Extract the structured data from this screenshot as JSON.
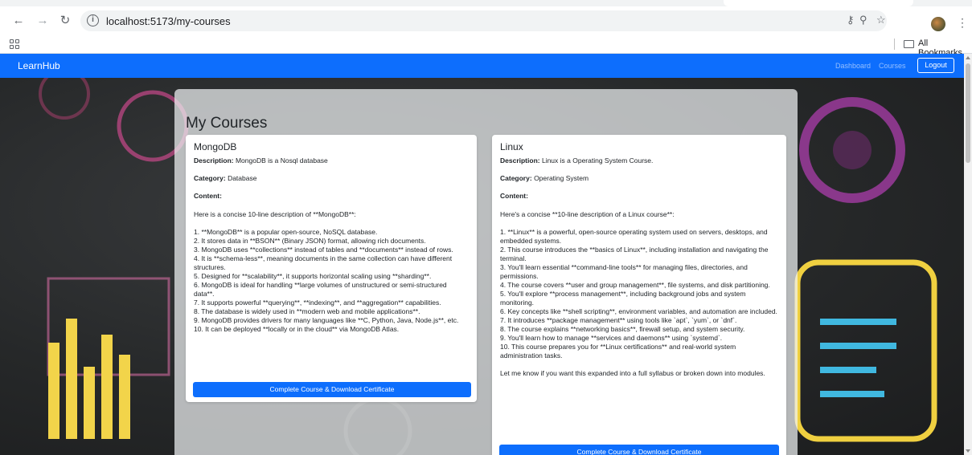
{
  "browser": {
    "url": "localhost:5173/my-courses",
    "bookmarks_label": "All Bookmarks"
  },
  "navbar": {
    "brand": "LearnHub",
    "links": [
      "Dashboard",
      "Courses"
    ],
    "logout_label": "Logout"
  },
  "page": {
    "title": "My Courses"
  },
  "labels": {
    "description": "Description:",
    "category": "Category:",
    "content": "Content:"
  },
  "courses": [
    {
      "title": "MongoDB",
      "description": "MongoDB is a Nosql database",
      "category": "Database",
      "content": "Here is a concise 10-line description of **MongoDB**:\n\n1. **MongoDB** is a popular open-source, NoSQL database.\n2. It stores data in **BSON** (Binary JSON) format, allowing rich documents.\n3. MongoDB uses **collections** instead of tables and **documents** instead of rows.\n4. It is **schema-less**, meaning documents in the same collection can have different structures.\n5. Designed for **scalability**, it supports horizontal scaling using **sharding**.\n6. MongoDB is ideal for handling **large volumes of unstructured or semi-structured data**.\n7. It supports powerful **querying**, **indexing**, and **aggregation** capabilities.\n8. The database is widely used in **modern web and mobile applications**.\n9. MongoDB provides drivers for many languages like **C, Python, Java, Node.js**, etc.\n10. It can be deployed **locally or in the cloud** via MongoDB Atlas.",
      "button_label": "Complete Course & Download Certificate"
    },
    {
      "title": "Linux",
      "description": "Linux is a Operating System Course.",
      "category": "Operating System",
      "content": "Here's a concise **10-line description of a Linux course**:\n\n1. **Linux** is a powerful, open-source operating system used on servers, desktops, and embedded systems.\n2. This course introduces the **basics of Linux**, including installation and navigating the terminal.\n3. You'll learn essential **command-line tools** for managing files, directories, and permissions.\n4. The course covers **user and group management**, file systems, and disk partitioning.\n5. You'll explore **process management**, including background jobs and system monitoring.\n6. Key concepts like **shell scripting**, environment variables, and automation are included.\n7. It introduces **package management** using tools like `apt`, `yum`, or `dnf`.\n8. The course explains **networking basics**, firewall setup, and system security.\n9. You'll learn how to manage **services and daemons** using `systemd`.\n10. This course prepares you for **Linux certifications** and real-world system administration tasks.\n\nLet me know if you want this expanded into a full syllabus or broken down into modules.",
      "button_label": "Complete Course & Download Certificate"
    }
  ]
}
